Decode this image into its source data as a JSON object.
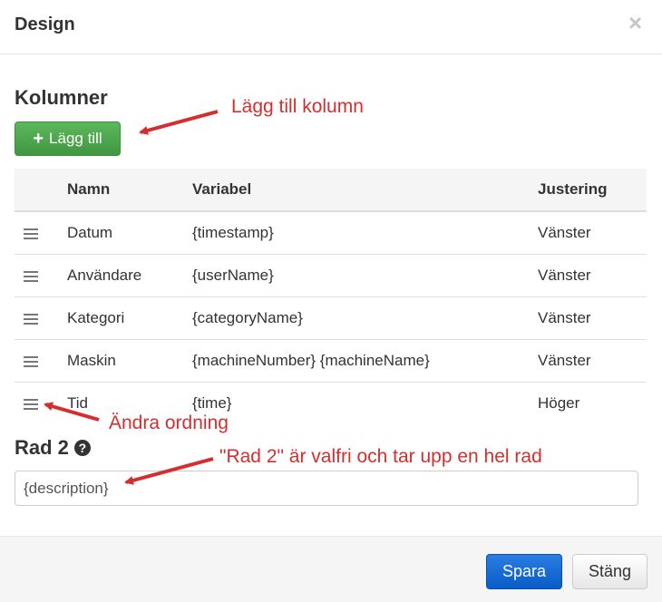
{
  "dialog": {
    "title": "Design",
    "close_glyph": "×"
  },
  "columns_section": {
    "title": "Kolumner",
    "add_button": {
      "icon": "plus-icon",
      "glyph": "+",
      "label": "Lägg till"
    },
    "headers": [
      "",
      "Namn",
      "Variabel",
      "Justering"
    ],
    "rows": [
      {
        "name": "Datum",
        "variable": "{timestamp}",
        "alignment": "Vänster"
      },
      {
        "name": "Användare",
        "variable": "{userName}",
        "alignment": "Vänster"
      },
      {
        "name": "Kategori",
        "variable": "{categoryName}",
        "alignment": "Vänster"
      },
      {
        "name": "Maskin",
        "variable": "{machineNumber} {machineName}",
        "alignment": "Vänster"
      },
      {
        "name": "Tid",
        "variable": "{time}",
        "alignment": "Höger"
      }
    ]
  },
  "row2": {
    "label": "Rad 2",
    "help_glyph": "?",
    "value": "{description}"
  },
  "footer": {
    "save_label": "Spara",
    "close_label": "Stäng"
  },
  "annotations": {
    "add_column": "Lägg till kolumn",
    "reorder": "Ändra ordning",
    "row2_note": "\"Rad 2\" är valfri och tar upp en hel rad"
  },
  "colors": {
    "annotation": "#d32f2f",
    "success": "#4cae4c",
    "primary": "#0f62cc"
  }
}
